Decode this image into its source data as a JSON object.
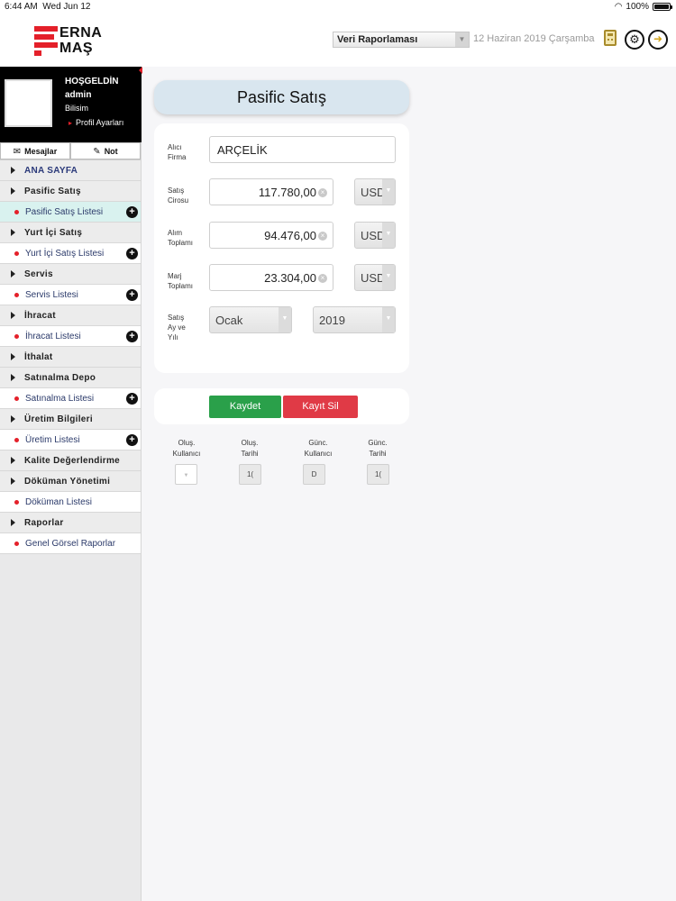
{
  "status_bar": {
    "time": "6:44 AM",
    "date": "Wed Jun 12",
    "battery": "100%"
  },
  "header": {
    "logo_line1": "ERNA",
    "logo_line2": "MAŞ",
    "report_select": "Veri Raporlaması",
    "date_text": "12 Haziran 2019 Çarşamba"
  },
  "user": {
    "welcome": "HOŞGELDİN",
    "name": "admin",
    "department": "Bilisim",
    "profile_link": "Profil Ayarları"
  },
  "tabs": {
    "messages": "Mesajlar",
    "note": "Not"
  },
  "menu": {
    "home": "ANA SAYFA",
    "pasific_satis": "Pasific Satış",
    "pasific_satis_listesi": "Pasific Satış Listesi",
    "yurt_ici_satis": "Yurt İçi Satış",
    "yurt_ici_satis_listesi": "Yurt İçi Satış Listesi",
    "servis": "Servis",
    "servis_listesi": "Servis Listesi",
    "ihracat": "İhracat",
    "ihracat_listesi": "İhracat Listesi",
    "ithalat": "İthalat",
    "satinalma_depo": "Satınalma Depo",
    "satinalma_listesi": "Satınalma Listesi",
    "uretim_bilgileri": "Üretim Bilgileri",
    "uretim_listesi": "Üretim Listesi",
    "kalite": "Kalite Değerlendirme",
    "dokuman_yonetimi": "Döküman Yönetimi",
    "dokuman_listesi": "Döküman Listesi",
    "raporlar": "Raporlar",
    "genel_gorsel_raporlar": "Genel Görsel Raporlar"
  },
  "form": {
    "title": "Pasific Satış",
    "alici_firma_label_1": "Alıcı",
    "alici_firma_label_2": "Firma",
    "alici_firma_value": "ARÇELİK",
    "satis_cirosu_label_1": "Satış",
    "satis_cirosu_label_2": "Cirosu",
    "satis_cirosu_value": "117.780,00",
    "satis_cirosu_currency": "USD",
    "alim_toplami_label_1": "Alım",
    "alim_toplami_label_2": "Toplamı",
    "alim_toplami_value": "94.476,00",
    "alim_toplami_currency": "USD",
    "marj_toplami_label_1": "Marj",
    "marj_toplami_label_2": "Toplamı",
    "marj_toplami_value": "23.304,00",
    "marj_toplami_currency": "USD",
    "satis_ay_yili_label_1": "Satış",
    "satis_ay_yili_label_2": "Ay ve",
    "satis_ay_yili_label_3": "Yılı",
    "month_value": "Ocak",
    "year_value": "2019",
    "save_label": "Kaydet",
    "delete_label": "Kayıt Sil"
  },
  "meta": {
    "olus_kullanici_1": "Oluş.",
    "olus_kullanici_2": "Kullanıcı",
    "olus_tarihi_1": "Oluş.",
    "olus_tarihi_2": "Tarihi",
    "gunc_kullanici_1": "Günc.",
    "gunc_kullanici_2": "Kullanıcı",
    "gunc_tarihi_1": "Günc.",
    "gunc_tarihi_2": "Tarihi",
    "olus_tarihi_value": "1(",
    "gunc_kullanici_value": "D",
    "gunc_tarihi_value": "1("
  }
}
